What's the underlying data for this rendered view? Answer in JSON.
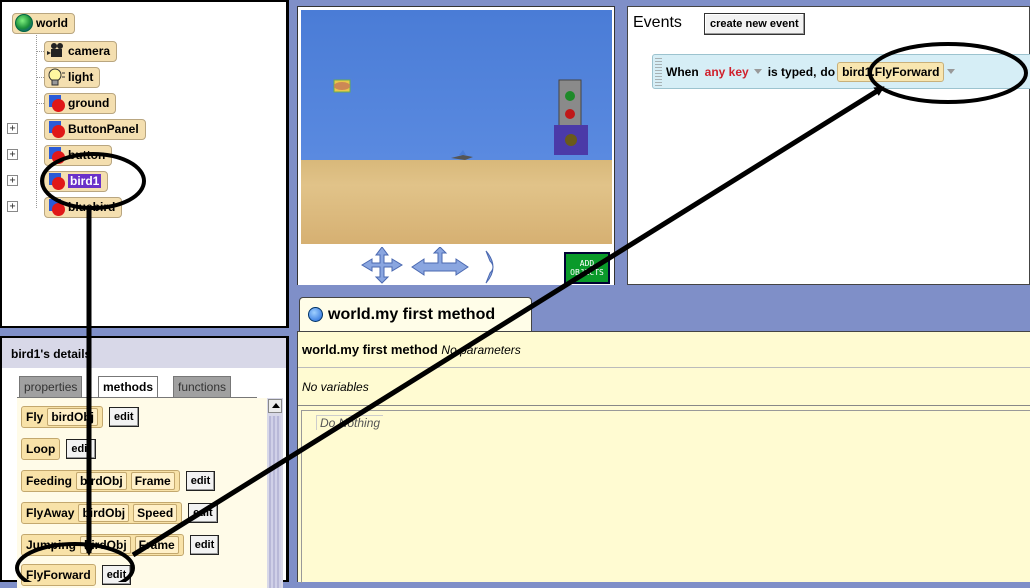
{
  "object_tree": {
    "items": [
      {
        "label": "world",
        "icon": "globe-icon"
      },
      {
        "label": "camera",
        "icon": "camera-icon"
      },
      {
        "label": "light",
        "icon": "lightbulb-icon"
      },
      {
        "label": "ground",
        "icon": "object-icon"
      },
      {
        "label": "ButtonPanel",
        "icon": "object-icon"
      },
      {
        "label": "button",
        "icon": "object-icon"
      },
      {
        "label": "bird1",
        "icon": "object-icon",
        "selected": true
      },
      {
        "label": "bluebird",
        "icon": "object-icon"
      }
    ]
  },
  "scene_view": {
    "add_objects_label": "ADD OBJECTS"
  },
  "events": {
    "title": "Events",
    "create_button": "create new event",
    "row": {
      "when": "When",
      "key": "any key",
      "is_typed": "is typed,",
      "do": "do",
      "method": "bird1.FlyForward"
    }
  },
  "details": {
    "title": "bird1's details",
    "tabs": [
      "properties",
      "methods",
      "functions"
    ],
    "active_tab": "methods",
    "edit_label": "edit",
    "methods": [
      {
        "name": "Fly",
        "params": [
          "birdObj"
        ]
      },
      {
        "name": "Loop",
        "params": []
      },
      {
        "name": "Feeding",
        "params": [
          "birdObj",
          "Frame"
        ]
      },
      {
        "name": "FlyAway",
        "params": [
          "birdObj",
          "Speed"
        ]
      },
      {
        "name": "Jumping",
        "params": [
          "birdObj",
          "Frame"
        ]
      },
      {
        "name": "FlyForward",
        "params": []
      }
    ]
  },
  "editor": {
    "tab_label": "world.my first method",
    "header_name": "world.my first method",
    "header_params": "No parameters",
    "variables": "No variables",
    "body": "Do Nothing"
  },
  "colors": {
    "background": "#7f8fc8",
    "selection": "#6a31c9",
    "event_row": "#d6eef6",
    "editor_bg": "#fffbd2",
    "add_objects": "#0a9a2a"
  }
}
